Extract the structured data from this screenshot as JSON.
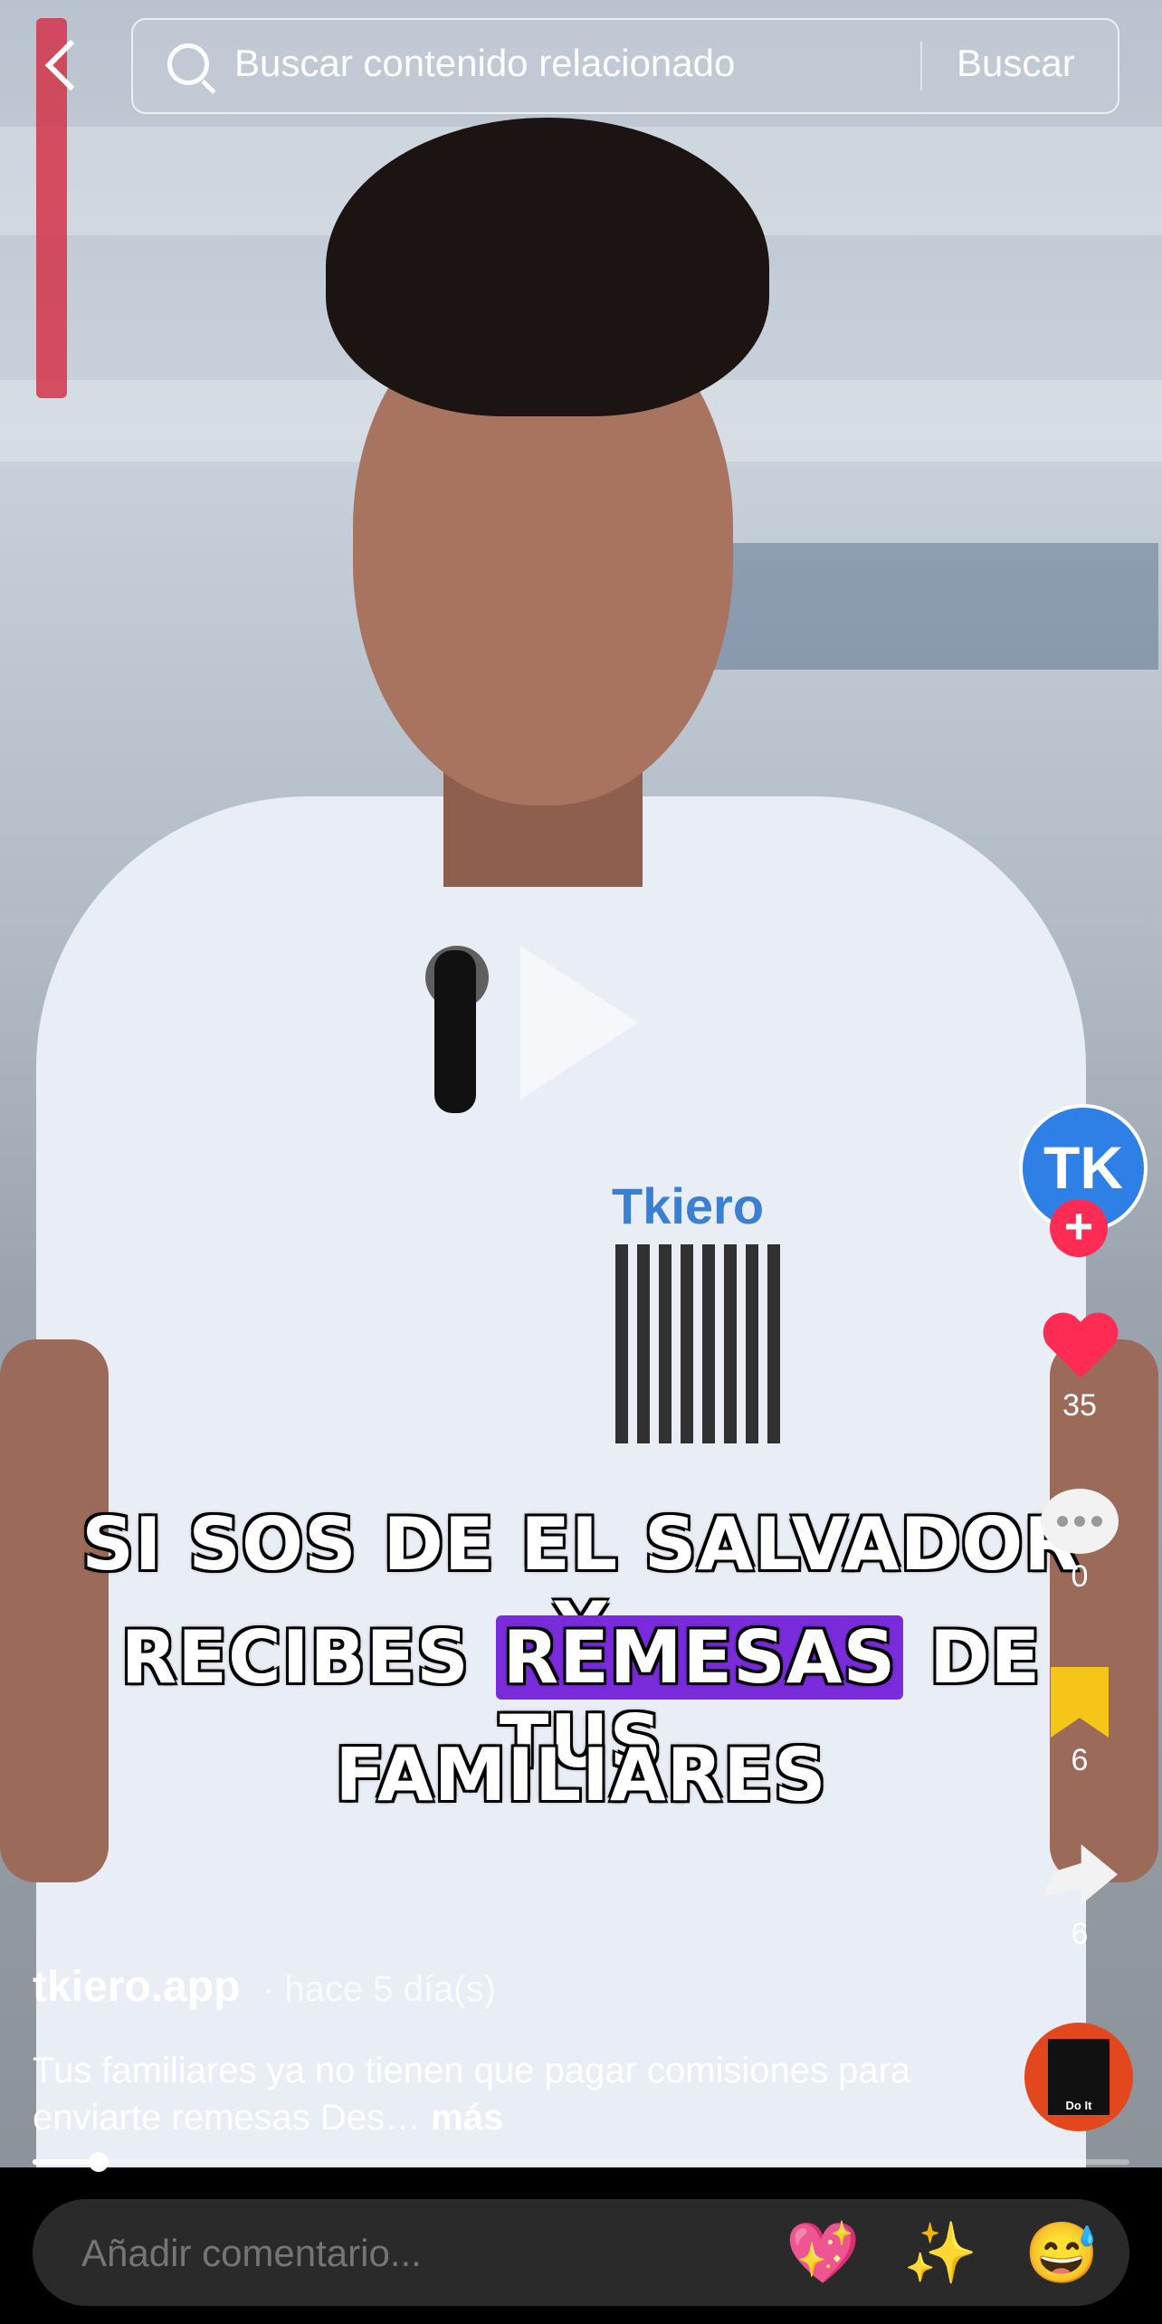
{
  "search": {
    "placeholder": "Buscar contenido relacionado",
    "button_label": "Buscar"
  },
  "video": {
    "caption_lines": [
      "SI SOS DE EL SALVADOR Y",
      "RECIBES",
      "REMESAS",
      "DE TUS",
      "FAMILIARES"
    ],
    "shirt_logo_text": "Tkiero"
  },
  "actions": {
    "likes": "35",
    "comments": "0",
    "bookmarks": "6",
    "shares": "6"
  },
  "post": {
    "username": "tkiero.app",
    "time_ago": "· hace 5 día(s)",
    "description": "Tus familiares ya no tienen que pagar comisiones para enviarte remesas  Des…",
    "more_label": "más"
  },
  "progress": {
    "fraction": 0.06
  },
  "comment_bar": {
    "placeholder": "Añadir comentario...",
    "emojis": [
      "💖",
      "✨",
      "😅"
    ]
  },
  "music": {
    "disc_label": "Do It"
  },
  "colors": {
    "like": "#fe2c55",
    "bookmark": "#f5c518",
    "caption_highlight": "#7a2bdc",
    "avatar": "#2e7fe6"
  }
}
